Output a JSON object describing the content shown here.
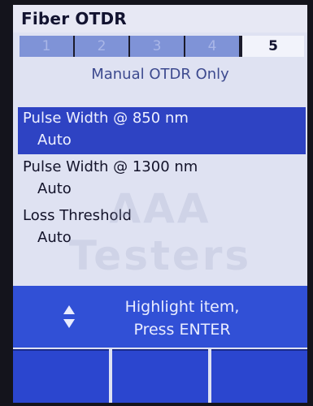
{
  "app": {
    "title": "Fiber OTDR"
  },
  "tabs": [
    {
      "label": "1"
    },
    {
      "label": "2"
    },
    {
      "label": "3"
    },
    {
      "label": "4"
    },
    {
      "label": "5"
    }
  ],
  "mode_label": "Manual OTDR Only",
  "settings": [
    {
      "name": "Pulse Width @  850 nm",
      "value": "Auto"
    },
    {
      "name": "Pulse Width @ 1300 nm",
      "value": "Auto"
    },
    {
      "name": "Loss Threshold",
      "value": "Auto"
    }
  ],
  "watermark": "AAA Testers",
  "hint": {
    "line1": "Highlight item,",
    "line2": "Press ENTER",
    "icon": "up-down-arrows-icon"
  },
  "softkeys": [
    {
      "label": ""
    },
    {
      "label": ""
    },
    {
      "label": ""
    }
  ],
  "colors": {
    "screen_bg": "#dfe2f2",
    "accent": "#2e43c3",
    "hint_bar": "#3150d6"
  }
}
